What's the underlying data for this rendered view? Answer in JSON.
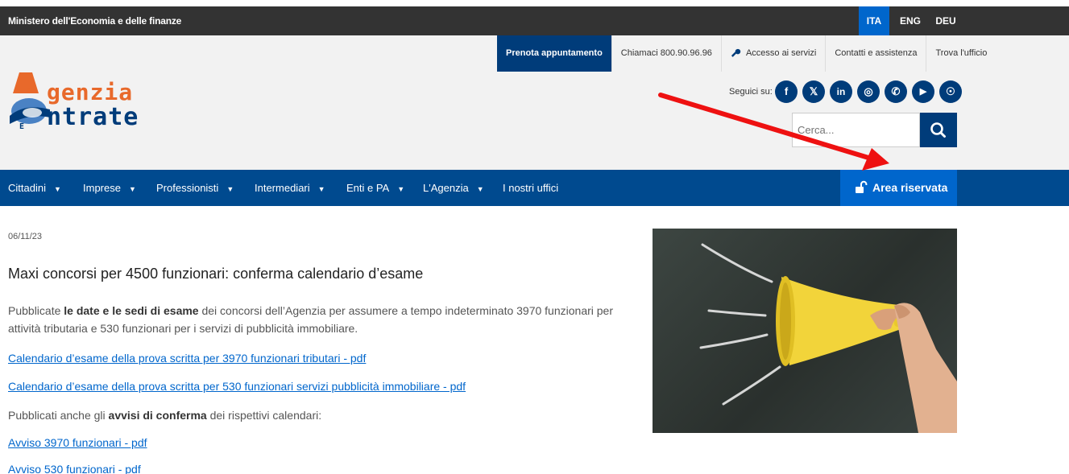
{
  "topbar": {
    "ministry": "Ministero dell'Economia e delle finanze",
    "languages": [
      "ITA",
      "ENG",
      "DEU"
    ],
    "active_language": "ITA"
  },
  "utility": {
    "book": "Prenota appuntamento",
    "call": "Chiamaci 800.90.96.96",
    "access": "Accesso ai servizi",
    "contacts": "Contatti e assistenza",
    "office": "Trova l'ufficio"
  },
  "logo": {
    "line1": "genzia",
    "line2": "ntrate",
    "letter1": "A",
    "letter2": "E"
  },
  "social": {
    "label": "Seguici su:",
    "icons": [
      "facebook-icon",
      "x-icon",
      "linkedin-icon",
      "instagram-icon",
      "whatsapp-icon",
      "youtube-icon",
      "rss-icon"
    ],
    "glyphs": [
      "f",
      "𝕏",
      "in",
      "◎",
      "✆",
      "▶",
      "☉"
    ]
  },
  "search": {
    "placeholder": "Cerca..."
  },
  "nav": {
    "items": [
      "Cittadini",
      "Imprese",
      "Professionisti",
      "Intermediari",
      "Enti e PA",
      "L'Agenzia",
      "I nostri uffici"
    ],
    "area_riservata": "Area riservata"
  },
  "article": {
    "date": "06/11/23",
    "title": "Maxi concorsi per 4500 funzionari: conferma calendario d’esame",
    "p1_pre": "Pubblicate ",
    "p1_bold": "le date e le sedi di esame",
    "p1_post": " dei concorsi dell’Agenzia per assumere a tempo indeterminato 3970 funzionari per attività tributaria e 530 funzionari per i servizi di pubblicità immobiliare.",
    "link1": "Calendario d’esame della prova scritta per 3970 funzionari tributari - pdf",
    "link2": "Calendario d’esame della prova scritta per 530 funzionari servizi pubblicità immobiliare - pdf",
    "p2_pre": "Pubblicati anche gli ",
    "p2_bold": "avvisi di conferma",
    "p2_post": " dei rispettivi calendari:",
    "link3": "Avviso 3970 funzionari - pdf",
    "link4": "Avviso 530 funzionari - pdf"
  },
  "colors": {
    "dark_bar": "#333333",
    "brand_blue": "#003c7a",
    "nav_blue": "#004a8f",
    "accent_blue": "#0066cc",
    "logo_orange": "#e8692b",
    "annotation_red": "#ee1111"
  }
}
